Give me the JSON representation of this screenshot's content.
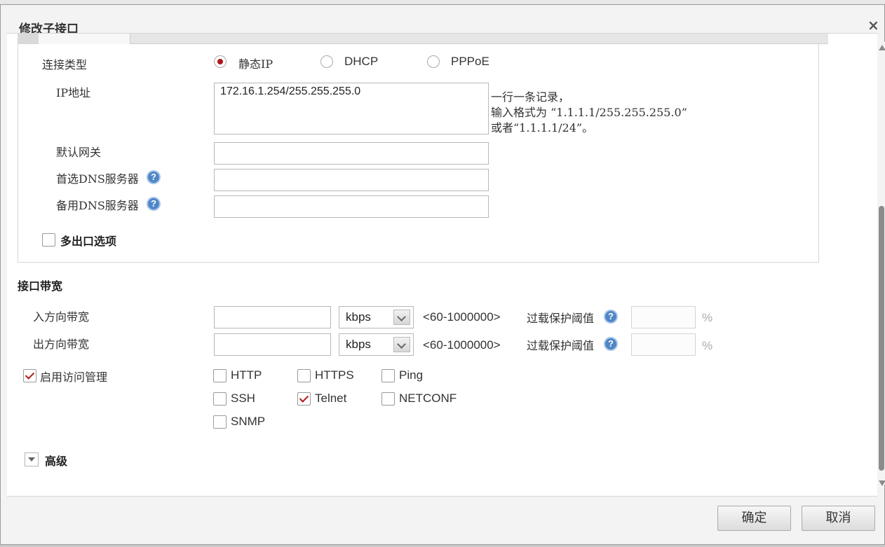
{
  "dialog": {
    "title": "修改子接口",
    "close_label": "×"
  },
  "connection": {
    "label": "连接类型",
    "options": [
      {
        "label": "静态IP",
        "selected": true
      },
      {
        "label": "DHCP",
        "selected": false
      },
      {
        "label": "PPPoE",
        "selected": false
      }
    ]
  },
  "ip": {
    "label": "IP地址",
    "value": "172.16.1.254/255.255.255.0",
    "hint_line1": "一行一条记录，",
    "hint_line2": "输入格式为 “1.1.1.1/255.255.255.0”",
    "hint_line3": "或者“1.1.1.1/24”。"
  },
  "gateway": {
    "label": "默认网关",
    "value": ""
  },
  "dns1": {
    "label": "首选DNS服务器",
    "value": ""
  },
  "dns2": {
    "label": "备用DNS服务器",
    "value": ""
  },
  "multi_exit": {
    "label": "多出口选项",
    "checked": false
  },
  "bandwidth": {
    "section_title": "接口带宽",
    "inbound": {
      "label": "入方向带宽",
      "value": "",
      "unit": "kbps",
      "range": "<60-1000000>",
      "threshold_label": "过载保护阈值",
      "threshold_value": "",
      "percent": "%"
    },
    "outbound": {
      "label": "出方向带宽",
      "value": "",
      "unit": "kbps",
      "range": "<60-1000000>",
      "threshold_label": "过载保护阈值",
      "threshold_value": "",
      "percent": "%"
    }
  },
  "access": {
    "label": "启用访问管理",
    "checked": true,
    "services": [
      {
        "label": "HTTP",
        "checked": false
      },
      {
        "label": "HTTPS",
        "checked": false
      },
      {
        "label": "Ping",
        "checked": false
      },
      {
        "label": "SSH",
        "checked": false
      },
      {
        "label": "Telnet",
        "checked": true
      },
      {
        "label": "NETCONF",
        "checked": false
      },
      {
        "label": "SNMP",
        "checked": false
      }
    ]
  },
  "advanced": {
    "label": "高级"
  },
  "footer": {
    "ok_label": "确定",
    "cancel_label": "取消"
  },
  "help_glyph": "?",
  "icons": {
    "help": "help-icon",
    "dropdown": "chevron-down-icon",
    "close": "close-icon",
    "expand": "triangle-down-icon"
  },
  "colors": {
    "accent": "#b01818",
    "help": "#4f86c6"
  }
}
